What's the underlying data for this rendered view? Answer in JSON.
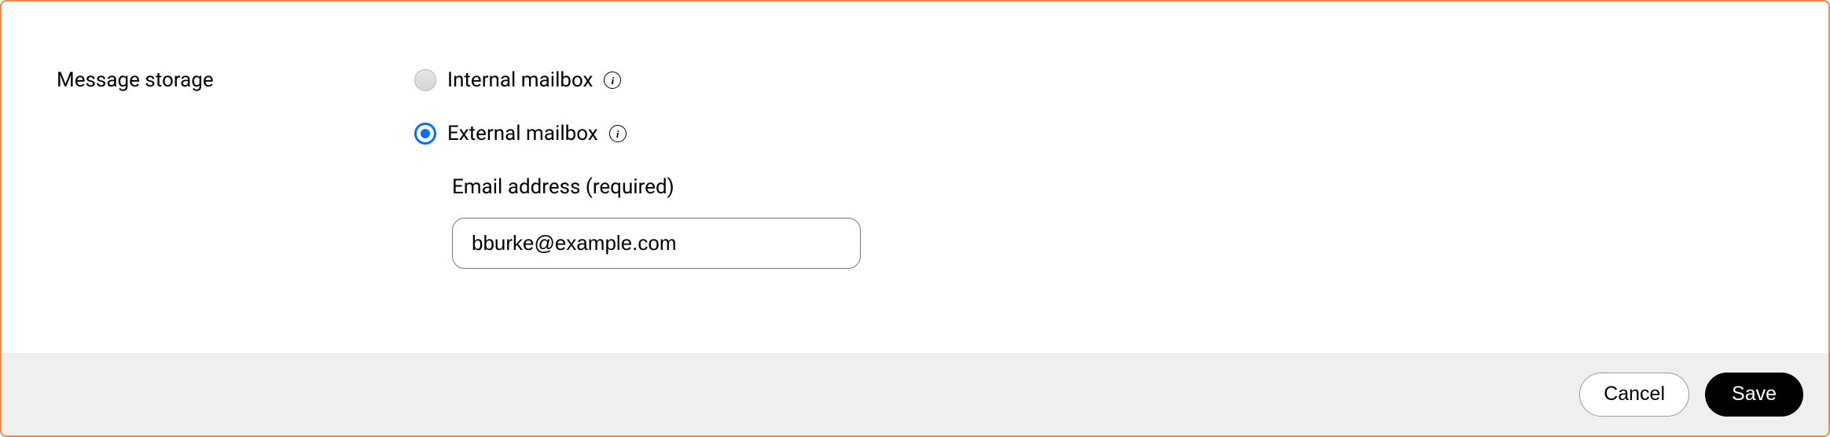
{
  "section": {
    "title": "Message storage"
  },
  "options": {
    "internal": {
      "label": "Internal mailbox",
      "selected": false
    },
    "external": {
      "label": "External mailbox",
      "selected": true
    }
  },
  "email_field": {
    "label": "Email address (required)",
    "value": "bburke@example.com"
  },
  "footer": {
    "cancel_label": "Cancel",
    "save_label": "Save"
  },
  "icons": {
    "info_glyph": "i"
  }
}
